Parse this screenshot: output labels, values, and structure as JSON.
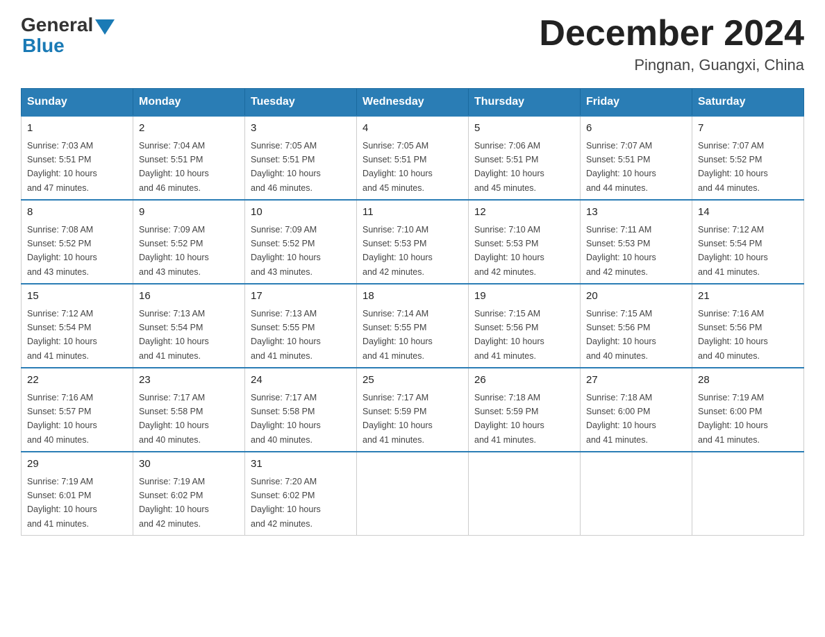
{
  "logo": {
    "general": "General",
    "blue": "Blue"
  },
  "header": {
    "title": "December 2024",
    "location": "Pingnan, Guangxi, China"
  },
  "weekdays": [
    "Sunday",
    "Monday",
    "Tuesday",
    "Wednesday",
    "Thursday",
    "Friday",
    "Saturday"
  ],
  "weeks": [
    [
      {
        "day": "1",
        "sunrise": "7:03 AM",
        "sunset": "5:51 PM",
        "daylight": "10 hours and 47 minutes."
      },
      {
        "day": "2",
        "sunrise": "7:04 AM",
        "sunset": "5:51 PM",
        "daylight": "10 hours and 46 minutes."
      },
      {
        "day": "3",
        "sunrise": "7:05 AM",
        "sunset": "5:51 PM",
        "daylight": "10 hours and 46 minutes."
      },
      {
        "day": "4",
        "sunrise": "7:05 AM",
        "sunset": "5:51 PM",
        "daylight": "10 hours and 45 minutes."
      },
      {
        "day": "5",
        "sunrise": "7:06 AM",
        "sunset": "5:51 PM",
        "daylight": "10 hours and 45 minutes."
      },
      {
        "day": "6",
        "sunrise": "7:07 AM",
        "sunset": "5:51 PM",
        "daylight": "10 hours and 44 minutes."
      },
      {
        "day": "7",
        "sunrise": "7:07 AM",
        "sunset": "5:52 PM",
        "daylight": "10 hours and 44 minutes."
      }
    ],
    [
      {
        "day": "8",
        "sunrise": "7:08 AM",
        "sunset": "5:52 PM",
        "daylight": "10 hours and 43 minutes."
      },
      {
        "day": "9",
        "sunrise": "7:09 AM",
        "sunset": "5:52 PM",
        "daylight": "10 hours and 43 minutes."
      },
      {
        "day": "10",
        "sunrise": "7:09 AM",
        "sunset": "5:52 PM",
        "daylight": "10 hours and 43 minutes."
      },
      {
        "day": "11",
        "sunrise": "7:10 AM",
        "sunset": "5:53 PM",
        "daylight": "10 hours and 42 minutes."
      },
      {
        "day": "12",
        "sunrise": "7:10 AM",
        "sunset": "5:53 PM",
        "daylight": "10 hours and 42 minutes."
      },
      {
        "day": "13",
        "sunrise": "7:11 AM",
        "sunset": "5:53 PM",
        "daylight": "10 hours and 42 minutes."
      },
      {
        "day": "14",
        "sunrise": "7:12 AM",
        "sunset": "5:54 PM",
        "daylight": "10 hours and 41 minutes."
      }
    ],
    [
      {
        "day": "15",
        "sunrise": "7:12 AM",
        "sunset": "5:54 PM",
        "daylight": "10 hours and 41 minutes."
      },
      {
        "day": "16",
        "sunrise": "7:13 AM",
        "sunset": "5:54 PM",
        "daylight": "10 hours and 41 minutes."
      },
      {
        "day": "17",
        "sunrise": "7:13 AM",
        "sunset": "5:55 PM",
        "daylight": "10 hours and 41 minutes."
      },
      {
        "day": "18",
        "sunrise": "7:14 AM",
        "sunset": "5:55 PM",
        "daylight": "10 hours and 41 minutes."
      },
      {
        "day": "19",
        "sunrise": "7:15 AM",
        "sunset": "5:56 PM",
        "daylight": "10 hours and 41 minutes."
      },
      {
        "day": "20",
        "sunrise": "7:15 AM",
        "sunset": "5:56 PM",
        "daylight": "10 hours and 40 minutes."
      },
      {
        "day": "21",
        "sunrise": "7:16 AM",
        "sunset": "5:56 PM",
        "daylight": "10 hours and 40 minutes."
      }
    ],
    [
      {
        "day": "22",
        "sunrise": "7:16 AM",
        "sunset": "5:57 PM",
        "daylight": "10 hours and 40 minutes."
      },
      {
        "day": "23",
        "sunrise": "7:17 AM",
        "sunset": "5:58 PM",
        "daylight": "10 hours and 40 minutes."
      },
      {
        "day": "24",
        "sunrise": "7:17 AM",
        "sunset": "5:58 PM",
        "daylight": "10 hours and 40 minutes."
      },
      {
        "day": "25",
        "sunrise": "7:17 AM",
        "sunset": "5:59 PM",
        "daylight": "10 hours and 41 minutes."
      },
      {
        "day": "26",
        "sunrise": "7:18 AM",
        "sunset": "5:59 PM",
        "daylight": "10 hours and 41 minutes."
      },
      {
        "day": "27",
        "sunrise": "7:18 AM",
        "sunset": "6:00 PM",
        "daylight": "10 hours and 41 minutes."
      },
      {
        "day": "28",
        "sunrise": "7:19 AM",
        "sunset": "6:00 PM",
        "daylight": "10 hours and 41 minutes."
      }
    ],
    [
      {
        "day": "29",
        "sunrise": "7:19 AM",
        "sunset": "6:01 PM",
        "daylight": "10 hours and 41 minutes."
      },
      {
        "day": "30",
        "sunrise": "7:19 AM",
        "sunset": "6:02 PM",
        "daylight": "10 hours and 42 minutes."
      },
      {
        "day": "31",
        "sunrise": "7:20 AM",
        "sunset": "6:02 PM",
        "daylight": "10 hours and 42 minutes."
      },
      null,
      null,
      null,
      null
    ]
  ],
  "labels": {
    "sunrise": "Sunrise:",
    "sunset": "Sunset:",
    "daylight": "Daylight:"
  }
}
